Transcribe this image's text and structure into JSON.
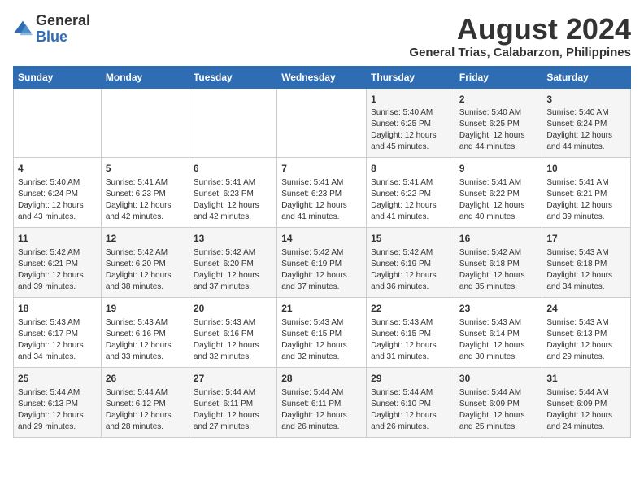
{
  "logo": {
    "text_general": "General",
    "text_blue": "Blue"
  },
  "header": {
    "month": "August 2024",
    "location": "General Trias, Calabarzon, Philippines"
  },
  "days_of_week": [
    "Sunday",
    "Monday",
    "Tuesday",
    "Wednesday",
    "Thursday",
    "Friday",
    "Saturday"
  ],
  "weeks": [
    [
      {
        "day": "",
        "info": ""
      },
      {
        "day": "",
        "info": ""
      },
      {
        "day": "",
        "info": ""
      },
      {
        "day": "",
        "info": ""
      },
      {
        "day": "1",
        "info": "Sunrise: 5:40 AM\nSunset: 6:25 PM\nDaylight: 12 hours\nand 45 minutes."
      },
      {
        "day": "2",
        "info": "Sunrise: 5:40 AM\nSunset: 6:25 PM\nDaylight: 12 hours\nand 44 minutes."
      },
      {
        "day": "3",
        "info": "Sunrise: 5:40 AM\nSunset: 6:24 PM\nDaylight: 12 hours\nand 44 minutes."
      }
    ],
    [
      {
        "day": "4",
        "info": "Sunrise: 5:40 AM\nSunset: 6:24 PM\nDaylight: 12 hours\nand 43 minutes."
      },
      {
        "day": "5",
        "info": "Sunrise: 5:41 AM\nSunset: 6:23 PM\nDaylight: 12 hours\nand 42 minutes."
      },
      {
        "day": "6",
        "info": "Sunrise: 5:41 AM\nSunset: 6:23 PM\nDaylight: 12 hours\nand 42 minutes."
      },
      {
        "day": "7",
        "info": "Sunrise: 5:41 AM\nSunset: 6:23 PM\nDaylight: 12 hours\nand 41 minutes."
      },
      {
        "day": "8",
        "info": "Sunrise: 5:41 AM\nSunset: 6:22 PM\nDaylight: 12 hours\nand 41 minutes."
      },
      {
        "day": "9",
        "info": "Sunrise: 5:41 AM\nSunset: 6:22 PM\nDaylight: 12 hours\nand 40 minutes."
      },
      {
        "day": "10",
        "info": "Sunrise: 5:41 AM\nSunset: 6:21 PM\nDaylight: 12 hours\nand 39 minutes."
      }
    ],
    [
      {
        "day": "11",
        "info": "Sunrise: 5:42 AM\nSunset: 6:21 PM\nDaylight: 12 hours\nand 39 minutes."
      },
      {
        "day": "12",
        "info": "Sunrise: 5:42 AM\nSunset: 6:20 PM\nDaylight: 12 hours\nand 38 minutes."
      },
      {
        "day": "13",
        "info": "Sunrise: 5:42 AM\nSunset: 6:20 PM\nDaylight: 12 hours\nand 37 minutes."
      },
      {
        "day": "14",
        "info": "Sunrise: 5:42 AM\nSunset: 6:19 PM\nDaylight: 12 hours\nand 37 minutes."
      },
      {
        "day": "15",
        "info": "Sunrise: 5:42 AM\nSunset: 6:19 PM\nDaylight: 12 hours\nand 36 minutes."
      },
      {
        "day": "16",
        "info": "Sunrise: 5:42 AM\nSunset: 6:18 PM\nDaylight: 12 hours\nand 35 minutes."
      },
      {
        "day": "17",
        "info": "Sunrise: 5:43 AM\nSunset: 6:18 PM\nDaylight: 12 hours\nand 34 minutes."
      }
    ],
    [
      {
        "day": "18",
        "info": "Sunrise: 5:43 AM\nSunset: 6:17 PM\nDaylight: 12 hours\nand 34 minutes."
      },
      {
        "day": "19",
        "info": "Sunrise: 5:43 AM\nSunset: 6:16 PM\nDaylight: 12 hours\nand 33 minutes."
      },
      {
        "day": "20",
        "info": "Sunrise: 5:43 AM\nSunset: 6:16 PM\nDaylight: 12 hours\nand 32 minutes."
      },
      {
        "day": "21",
        "info": "Sunrise: 5:43 AM\nSunset: 6:15 PM\nDaylight: 12 hours\nand 32 minutes."
      },
      {
        "day": "22",
        "info": "Sunrise: 5:43 AM\nSunset: 6:15 PM\nDaylight: 12 hours\nand 31 minutes."
      },
      {
        "day": "23",
        "info": "Sunrise: 5:43 AM\nSunset: 6:14 PM\nDaylight: 12 hours\nand 30 minutes."
      },
      {
        "day": "24",
        "info": "Sunrise: 5:43 AM\nSunset: 6:13 PM\nDaylight: 12 hours\nand 29 minutes."
      }
    ],
    [
      {
        "day": "25",
        "info": "Sunrise: 5:44 AM\nSunset: 6:13 PM\nDaylight: 12 hours\nand 29 minutes."
      },
      {
        "day": "26",
        "info": "Sunrise: 5:44 AM\nSunset: 6:12 PM\nDaylight: 12 hours\nand 28 minutes."
      },
      {
        "day": "27",
        "info": "Sunrise: 5:44 AM\nSunset: 6:11 PM\nDaylight: 12 hours\nand 27 minutes."
      },
      {
        "day": "28",
        "info": "Sunrise: 5:44 AM\nSunset: 6:11 PM\nDaylight: 12 hours\nand 26 minutes."
      },
      {
        "day": "29",
        "info": "Sunrise: 5:44 AM\nSunset: 6:10 PM\nDaylight: 12 hours\nand 26 minutes."
      },
      {
        "day": "30",
        "info": "Sunrise: 5:44 AM\nSunset: 6:09 PM\nDaylight: 12 hours\nand 25 minutes."
      },
      {
        "day": "31",
        "info": "Sunrise: 5:44 AM\nSunset: 6:09 PM\nDaylight: 12 hours\nand 24 minutes."
      }
    ]
  ]
}
